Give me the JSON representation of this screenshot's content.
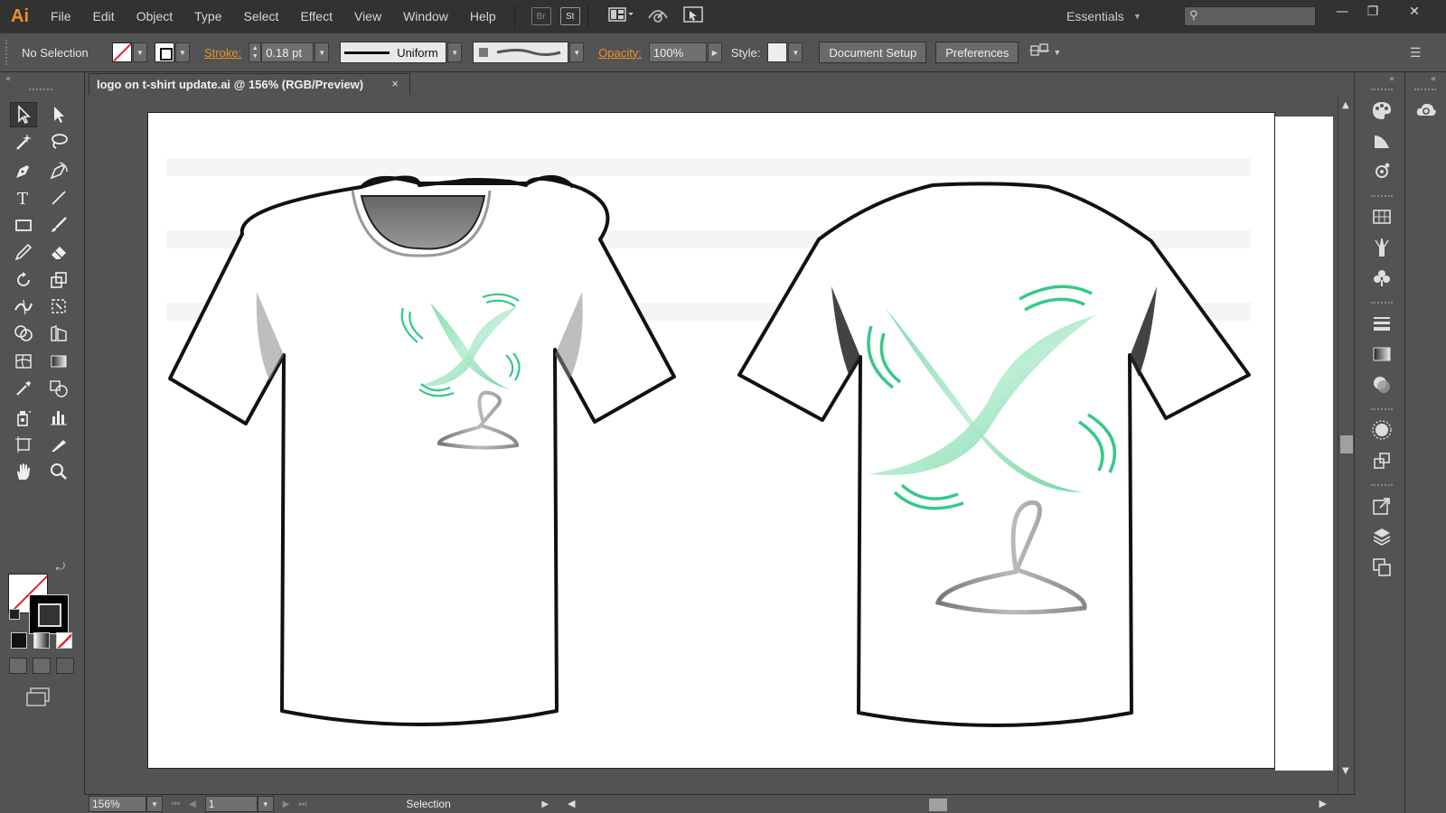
{
  "app": {
    "logo": "Ai",
    "menu": [
      "File",
      "Edit",
      "Object",
      "Type",
      "Select",
      "Effect",
      "View",
      "Window",
      "Help"
    ],
    "bridge_label": "Br",
    "stock_label": "St",
    "workspace": "Essentials",
    "search_placeholder": ""
  },
  "control_bar": {
    "selection_status": "No Selection",
    "stroke_label": "Stroke:",
    "stroke_weight": "0.18 pt",
    "stroke_profile": "Uniform",
    "opacity_label": "Opacity:",
    "opacity_value": "100%",
    "style_label": "Style:",
    "document_setup": "Document Setup",
    "preferences": "Preferences"
  },
  "document": {
    "tab_title": "logo on t-shirt update.ai @ 156% (RGB/Preview)",
    "close_glyph": "×"
  },
  "status_bar": {
    "zoom": "156%",
    "page": "1",
    "current_tool": "Selection"
  },
  "colors": {
    "accent_orange": "#e8902c",
    "logo_green": "#35c987",
    "none_red": "#e0202a"
  },
  "artwork": {
    "tshirt_front_color": "#ffffff",
    "tshirt_outline": "#111111",
    "logo_blade_color": "#7fd9ab",
    "hanger_color": "#8a8a8a"
  },
  "icons": {
    "tools": [
      "selection-tool-icon",
      "direct-selection-tool-icon",
      "magic-wand-icon",
      "lasso-icon",
      "pen-tool-icon",
      "curvature-tool-icon",
      "type-tool-icon",
      "line-tool-icon",
      "rectangle-tool-icon",
      "paintbrush-icon",
      "pencil-icon",
      "eraser-icon",
      "rotate-icon",
      "scale-icon",
      "width-tool-icon",
      "free-transform-icon",
      "shape-builder-icon",
      "perspective-grid-icon",
      "mesh-icon",
      "gradient-icon",
      "eyedropper-icon",
      "blend-icon",
      "symbol-sprayer-icon",
      "column-graph-icon",
      "artboard-tool-icon",
      "slice-icon",
      "hand-tool-icon",
      "zoom-tool-icon"
    ],
    "dock": [
      "color-icon",
      "color-guide-icon",
      "color-theme-icon",
      "swatches-icon",
      "brushes-icon",
      "symbols-icon",
      "stroke-icon",
      "gradient-panel-icon",
      "transparency-icon",
      "appearance-icon",
      "graphic-styles-icon",
      "export-icon",
      "layers-icon",
      "artboards-icon",
      "cc-libraries-icon"
    ]
  }
}
